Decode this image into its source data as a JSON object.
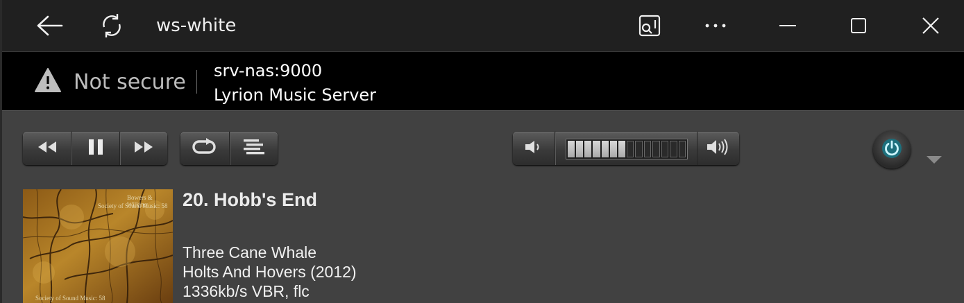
{
  "titlebar": {
    "title": "ws-white",
    "back_icon": "back-arrow-icon",
    "refresh_icon": "refresh-icon",
    "app_icon": "app-available-icon",
    "more_icon": "more-dots-icon",
    "minimize_icon": "minimize-icon",
    "maximize_icon": "maximize-icon",
    "close_icon": "close-icon"
  },
  "address": {
    "security_label": "Not secure",
    "security_icon": "warning-icon",
    "host": "srv-nas:9000",
    "page_title": "Lyrion Music Server"
  },
  "player": {
    "transport": [
      "rewind-icon",
      "pause-icon",
      "fast-forward-icon"
    ],
    "modes": [
      "repeat-icon",
      "playlist-icon"
    ],
    "volume": {
      "level": 0.5,
      "segments": 14,
      "filled": 7
    },
    "power_icon": "power-icon",
    "power_color": "#3fb6c7",
    "now_playing": {
      "title": "20. Hobb's End",
      "artist": "Three Cane Whale",
      "album": "Holts And Hovers (2012)",
      "format": "1336kb/s VBR, flc"
    },
    "cover": {
      "line1": "Bowers & Wilkins",
      "line2": "Society of Sound Music: 58",
      "line3": "Society of Sound Music: 58"
    }
  }
}
